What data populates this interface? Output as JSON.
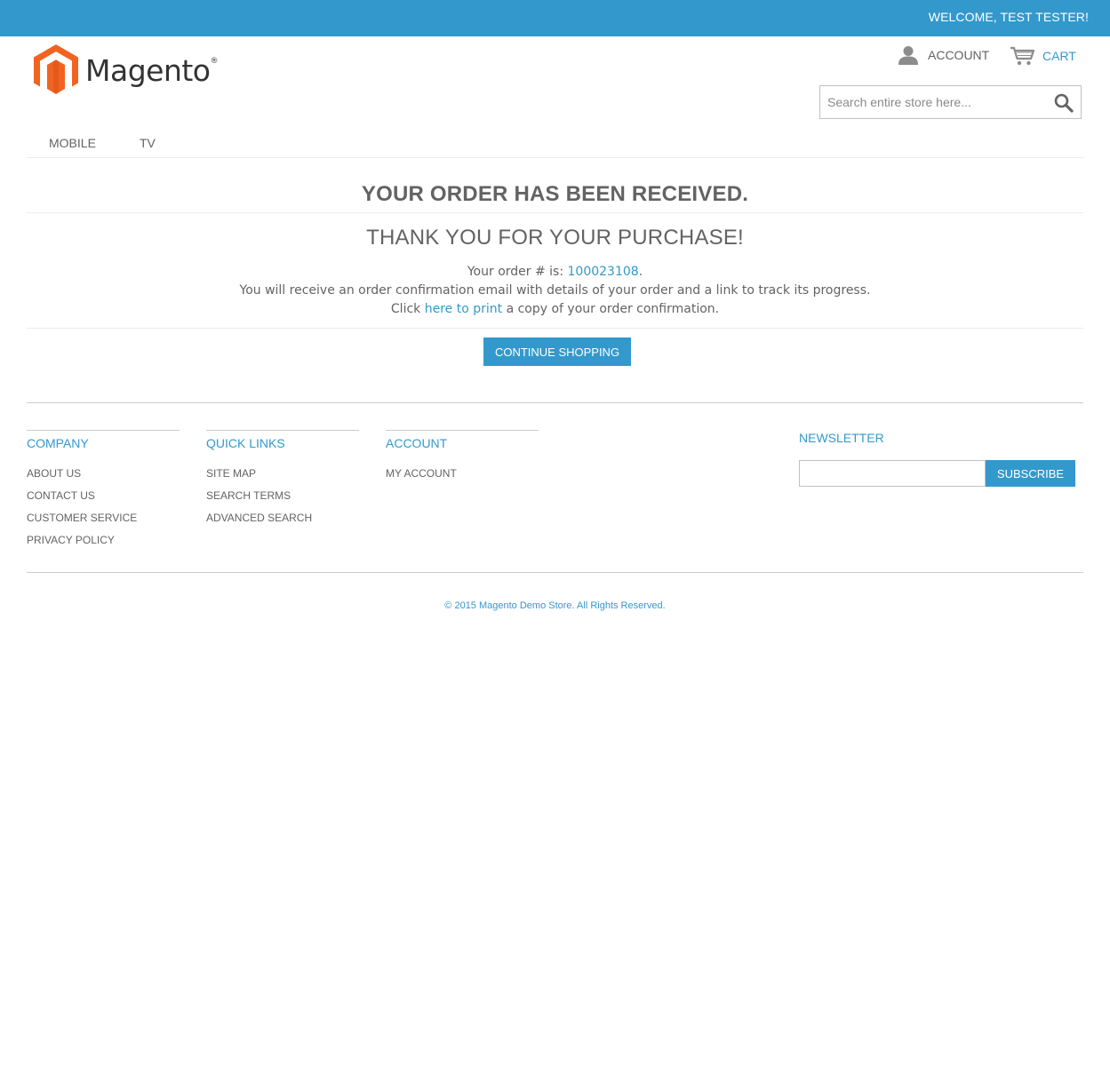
{
  "header": {
    "welcome": "WELCOME, TEST TESTER!",
    "logo_text": "Magento",
    "logo_reg": "®",
    "account_label": "ACCOUNT",
    "cart_label": "CART",
    "search_placeholder": "Search entire store here...",
    "icons": {
      "account": "person-icon",
      "cart": "cart-icon",
      "search": "magnifier-icon"
    }
  },
  "nav": {
    "items": [
      {
        "label": "MOBILE"
      },
      {
        "label": "TV"
      }
    ]
  },
  "main": {
    "heading": "YOUR ORDER HAS BEEN RECEIVED.",
    "subheading": "THANK YOU FOR YOUR PURCHASE!",
    "order_prefix": "Your order # is: ",
    "order_number": "100023108",
    "order_suffix": ".",
    "confirmation_text": "You will receive an order confirmation email with details of your order and a link to track its progress.",
    "print_prefix": "Click ",
    "print_link": "here to print",
    "print_suffix": " a copy of your order confirmation.",
    "continue_button": "CONTINUE SHOPPING"
  },
  "footer": {
    "columns": [
      {
        "title": "COMPANY",
        "links": [
          "ABOUT US",
          "CONTACT US",
          "CUSTOMER SERVICE",
          "PRIVACY POLICY"
        ]
      },
      {
        "title": "QUICK LINKS",
        "links": [
          "SITE MAP",
          "SEARCH TERMS",
          "ADVANCED SEARCH"
        ]
      },
      {
        "title": "ACCOUNT",
        "links": [
          "MY ACCOUNT"
        ]
      }
    ],
    "newsletter": {
      "title": "NEWSLETTER",
      "button": "SUBSCRIBE",
      "value": ""
    },
    "copyright": "© 2015 Magento Demo Store. All Rights Reserved."
  },
  "colors": {
    "accent": "#3399cc",
    "text": "#636363",
    "logo_orange": "#f26322"
  }
}
